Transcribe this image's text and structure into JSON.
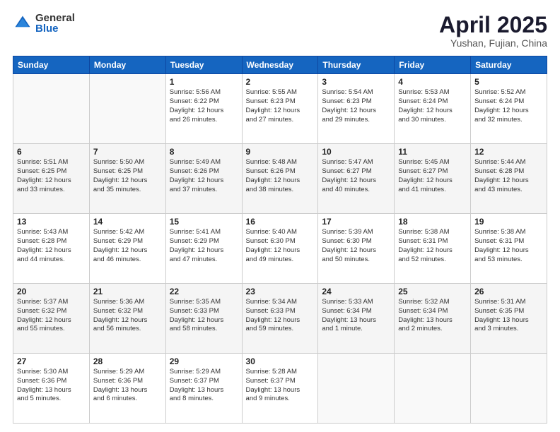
{
  "header": {
    "logo_general": "General",
    "logo_blue": "Blue",
    "title": "April 2025",
    "subtitle": "Yushan, Fujian, China"
  },
  "calendar": {
    "columns": [
      "Sunday",
      "Monday",
      "Tuesday",
      "Wednesday",
      "Thursday",
      "Friday",
      "Saturday"
    ],
    "rows": [
      [
        {
          "day": "",
          "info": ""
        },
        {
          "day": "",
          "info": ""
        },
        {
          "day": "1",
          "info": "Sunrise: 5:56 AM\nSunset: 6:22 PM\nDaylight: 12 hours\nand 26 minutes."
        },
        {
          "day": "2",
          "info": "Sunrise: 5:55 AM\nSunset: 6:23 PM\nDaylight: 12 hours\nand 27 minutes."
        },
        {
          "day": "3",
          "info": "Sunrise: 5:54 AM\nSunset: 6:23 PM\nDaylight: 12 hours\nand 29 minutes."
        },
        {
          "day": "4",
          "info": "Sunrise: 5:53 AM\nSunset: 6:24 PM\nDaylight: 12 hours\nand 30 minutes."
        },
        {
          "day": "5",
          "info": "Sunrise: 5:52 AM\nSunset: 6:24 PM\nDaylight: 12 hours\nand 32 minutes."
        }
      ],
      [
        {
          "day": "6",
          "info": "Sunrise: 5:51 AM\nSunset: 6:25 PM\nDaylight: 12 hours\nand 33 minutes."
        },
        {
          "day": "7",
          "info": "Sunrise: 5:50 AM\nSunset: 6:25 PM\nDaylight: 12 hours\nand 35 minutes."
        },
        {
          "day": "8",
          "info": "Sunrise: 5:49 AM\nSunset: 6:26 PM\nDaylight: 12 hours\nand 37 minutes."
        },
        {
          "day": "9",
          "info": "Sunrise: 5:48 AM\nSunset: 6:26 PM\nDaylight: 12 hours\nand 38 minutes."
        },
        {
          "day": "10",
          "info": "Sunrise: 5:47 AM\nSunset: 6:27 PM\nDaylight: 12 hours\nand 40 minutes."
        },
        {
          "day": "11",
          "info": "Sunrise: 5:45 AM\nSunset: 6:27 PM\nDaylight: 12 hours\nand 41 minutes."
        },
        {
          "day": "12",
          "info": "Sunrise: 5:44 AM\nSunset: 6:28 PM\nDaylight: 12 hours\nand 43 minutes."
        }
      ],
      [
        {
          "day": "13",
          "info": "Sunrise: 5:43 AM\nSunset: 6:28 PM\nDaylight: 12 hours\nand 44 minutes."
        },
        {
          "day": "14",
          "info": "Sunrise: 5:42 AM\nSunset: 6:29 PM\nDaylight: 12 hours\nand 46 minutes."
        },
        {
          "day": "15",
          "info": "Sunrise: 5:41 AM\nSunset: 6:29 PM\nDaylight: 12 hours\nand 47 minutes."
        },
        {
          "day": "16",
          "info": "Sunrise: 5:40 AM\nSunset: 6:30 PM\nDaylight: 12 hours\nand 49 minutes."
        },
        {
          "day": "17",
          "info": "Sunrise: 5:39 AM\nSunset: 6:30 PM\nDaylight: 12 hours\nand 50 minutes."
        },
        {
          "day": "18",
          "info": "Sunrise: 5:38 AM\nSunset: 6:31 PM\nDaylight: 12 hours\nand 52 minutes."
        },
        {
          "day": "19",
          "info": "Sunrise: 5:38 AM\nSunset: 6:31 PM\nDaylight: 12 hours\nand 53 minutes."
        }
      ],
      [
        {
          "day": "20",
          "info": "Sunrise: 5:37 AM\nSunset: 6:32 PM\nDaylight: 12 hours\nand 55 minutes."
        },
        {
          "day": "21",
          "info": "Sunrise: 5:36 AM\nSunset: 6:32 PM\nDaylight: 12 hours\nand 56 minutes."
        },
        {
          "day": "22",
          "info": "Sunrise: 5:35 AM\nSunset: 6:33 PM\nDaylight: 12 hours\nand 58 minutes."
        },
        {
          "day": "23",
          "info": "Sunrise: 5:34 AM\nSunset: 6:33 PM\nDaylight: 12 hours\nand 59 minutes."
        },
        {
          "day": "24",
          "info": "Sunrise: 5:33 AM\nSunset: 6:34 PM\nDaylight: 13 hours\nand 1 minute."
        },
        {
          "day": "25",
          "info": "Sunrise: 5:32 AM\nSunset: 6:34 PM\nDaylight: 13 hours\nand 2 minutes."
        },
        {
          "day": "26",
          "info": "Sunrise: 5:31 AM\nSunset: 6:35 PM\nDaylight: 13 hours\nand 3 minutes."
        }
      ],
      [
        {
          "day": "27",
          "info": "Sunrise: 5:30 AM\nSunset: 6:36 PM\nDaylight: 13 hours\nand 5 minutes."
        },
        {
          "day": "28",
          "info": "Sunrise: 5:29 AM\nSunset: 6:36 PM\nDaylight: 13 hours\nand 6 minutes."
        },
        {
          "day": "29",
          "info": "Sunrise: 5:29 AM\nSunset: 6:37 PM\nDaylight: 13 hours\nand 8 minutes."
        },
        {
          "day": "30",
          "info": "Sunrise: 5:28 AM\nSunset: 6:37 PM\nDaylight: 13 hours\nand 9 minutes."
        },
        {
          "day": "",
          "info": ""
        },
        {
          "day": "",
          "info": ""
        },
        {
          "day": "",
          "info": ""
        }
      ]
    ]
  }
}
